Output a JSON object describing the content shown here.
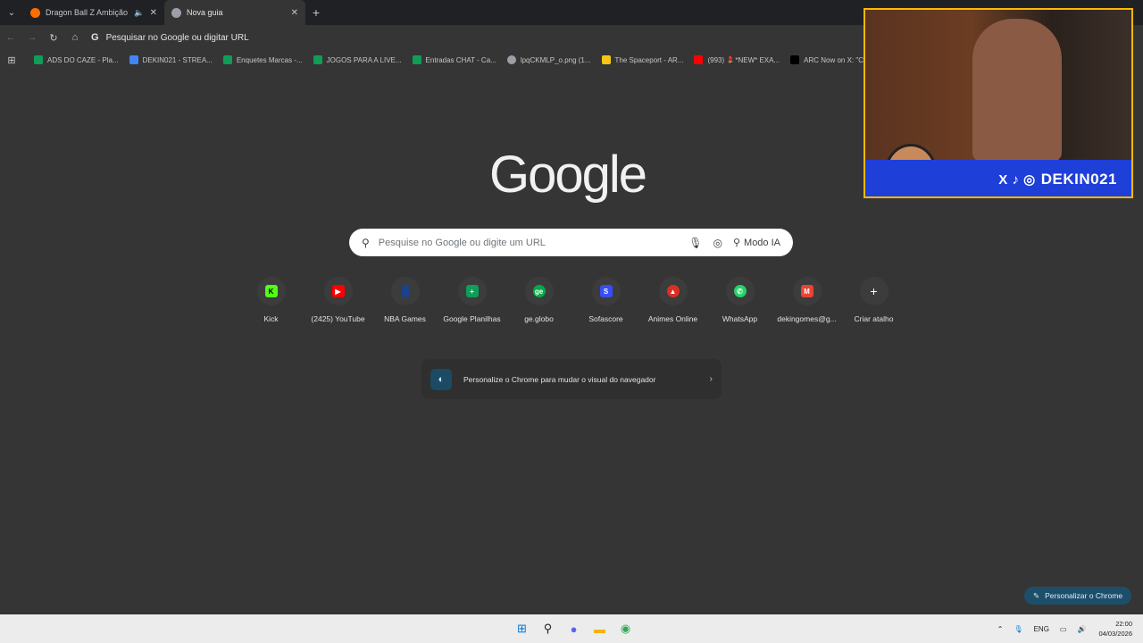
{
  "tabs": [
    {
      "title": "Dragon Ball Z Ambição de",
      "color": "#ff6d00",
      "audio": true,
      "active": false
    },
    {
      "title": "Nova guia",
      "color": "#9aa0a6",
      "audio": false,
      "active": true
    }
  ],
  "omnibox": {
    "text": "Pesquisar no Google ou digitar URL"
  },
  "bookmarks": [
    {
      "label": "ADS DO CAZE - Pla...",
      "color": "#0f9d58"
    },
    {
      "label": "DEKIN021 - STREA...",
      "color": "#4285f4"
    },
    {
      "label": "Enquetes Marcas -...",
      "color": "#0f9d58"
    },
    {
      "label": "JOGOS PARA A LIVE...",
      "color": "#0f9d58"
    },
    {
      "label": "Entradas CHAT - Ca...",
      "color": "#0f9d58"
    },
    {
      "label": "lpqCKMLP_o.png (1...",
      "color": "#9aa0a6"
    },
    {
      "label": "The Spaceport - AR...",
      "color": "#f5c518"
    },
    {
      "label": "(993) 💄*NEW* EXA...",
      "color": "#ff0000"
    },
    {
      "label": "ARC Now on X: \"Co...",
      "color": "#000000"
    }
  ],
  "logo": "Google",
  "search": {
    "placeholder": "Pesquise no Google ou digite um URL",
    "ai_mode": "Modo IA"
  },
  "shortcuts": [
    {
      "label": "Kick",
      "glyph": "K",
      "color": "#53fc18"
    },
    {
      "label": "(2425) YouTube",
      "glyph": "▶",
      "color": "#ff0000"
    },
    {
      "label": "NBA Games",
      "glyph": "N",
      "color": "#1d428a"
    },
    {
      "label": "Google Planilhas",
      "glyph": "+",
      "color": "#0f9d58"
    },
    {
      "label": "ge.globo",
      "glyph": "ge",
      "color": "#06aa48"
    },
    {
      "label": "Sofascore",
      "glyph": "S",
      "color": "#374df5"
    },
    {
      "label": "Animes Online",
      "glyph": "▲",
      "color": "#d93025"
    },
    {
      "label": "WhatsApp",
      "glyph": "✆",
      "color": "#25d366"
    },
    {
      "label": "dekingomes@g...",
      "glyph": "M",
      "color": "#ea4335"
    },
    {
      "label": "Criar atalho",
      "glyph": "+",
      "color": "#3c3c3c"
    }
  ],
  "customize_card": {
    "text": "Personalize o Chrome para mudar o visual do navegador"
  },
  "customize_button": "Personalizar o Chrome",
  "webcam": {
    "handle": "DEKIN021"
  },
  "taskbar": {
    "language": "ENG",
    "time": "22:00",
    "date": "04/03/2026"
  }
}
